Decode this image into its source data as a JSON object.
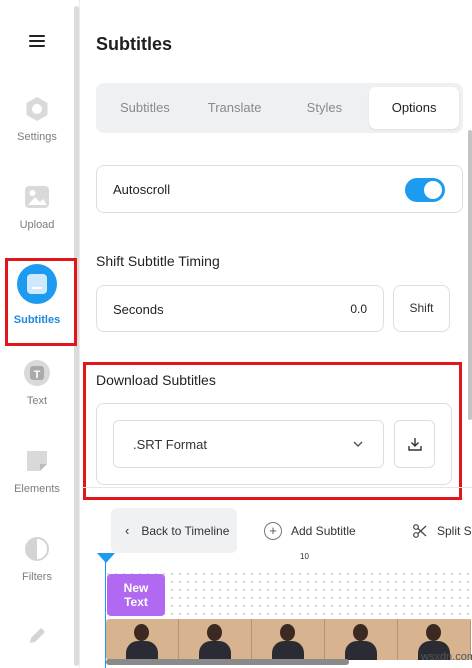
{
  "sidebar": {
    "items": [
      {
        "label": "Settings",
        "icon": "settings-hexagon-icon"
      },
      {
        "label": "Upload",
        "icon": "image-upload-icon"
      },
      {
        "label": "Subtitles",
        "icon": "subtitles-icon",
        "active": true
      },
      {
        "label": "Text",
        "icon": "text-t-icon"
      },
      {
        "label": "Elements",
        "icon": "sticky-note-icon"
      },
      {
        "label": "Filters",
        "icon": "half-circle-icon"
      },
      {
        "label": "",
        "icon": "pencil-icon"
      }
    ]
  },
  "panel": {
    "title": "Subtitles",
    "tabs": [
      {
        "label": "Subtitles"
      },
      {
        "label": "Translate"
      },
      {
        "label": "Styles"
      },
      {
        "label": "Options",
        "active": true
      }
    ],
    "autoscroll": {
      "label": "Autoscroll",
      "enabled": true
    },
    "shift": {
      "title": "Shift Subtitle Timing",
      "seconds_label": "Seconds",
      "seconds_value": "0.0",
      "button": "Shift"
    },
    "download": {
      "title": "Download Subtitles",
      "format": ".SRT Format"
    }
  },
  "timeline": {
    "back_label": "Back to Timeline",
    "add_subtitle_label": "Add Subtitle",
    "split_label": "Split S",
    "ruler_mark": "10",
    "text_clip": "New Text"
  },
  "watermark": "wsxdn.com",
  "colors": {
    "accent": "#1d9bf0",
    "highlight": "#e0161b",
    "clip": "#b069f0"
  }
}
